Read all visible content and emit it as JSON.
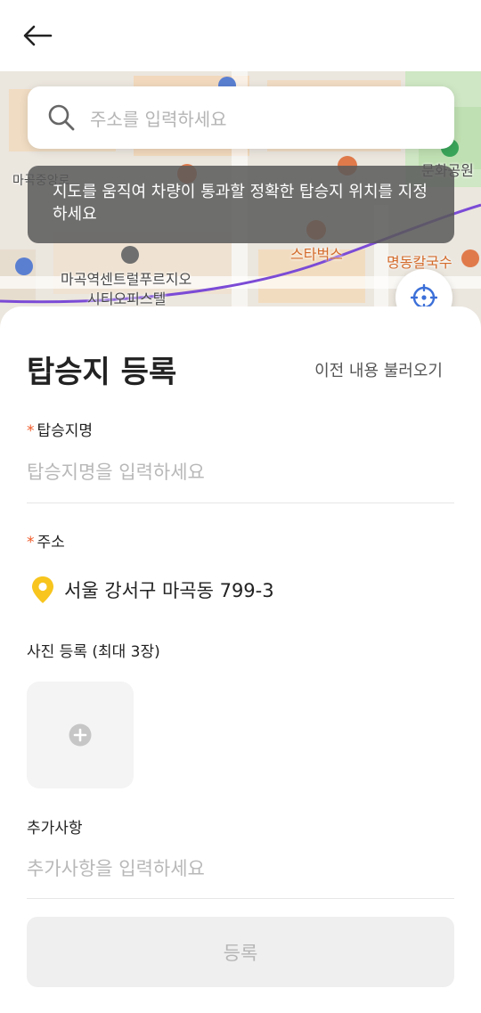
{
  "header": {
    "back_icon": "arrow-left-icon"
  },
  "search": {
    "placeholder": "주소를 입력하세요",
    "icon": "search-icon"
  },
  "toast": {
    "message": "지도를 움직여 차량이 통과할 정확한 탑승지 위치를 지정하세요"
  },
  "map": {
    "labels": {
      "culture_park": "문화공원",
      "magok_central": "마곡중앙로",
      "starbucks": "스타벅스",
      "noodles": "명동칼국수",
      "centre_line1": "마곡역센트럴푸르지오",
      "centre_line2": "시티오피스텔"
    },
    "route_color": "#7b4bd6",
    "locate_icon": "crosshair-icon"
  },
  "sheet": {
    "title": "탑승지 등록",
    "load_previous": "이전 내용 불러오기",
    "name": {
      "required_mark": "*",
      "label": "탑승지명",
      "placeholder": "탑승지명을 입력하세요"
    },
    "address": {
      "required_mark": "*",
      "label": "주소",
      "value": "서울 강서구 마곡동 799-3",
      "icon": "map-pin-icon",
      "pin_color": "#f7c51e"
    },
    "photos": {
      "label": "사진 등록 (최대 3장)",
      "add_icon": "plus-circle-icon"
    },
    "extra": {
      "label": "추가사항",
      "placeholder": "추가사항을 입력하세요"
    },
    "submit_label": "등록"
  }
}
